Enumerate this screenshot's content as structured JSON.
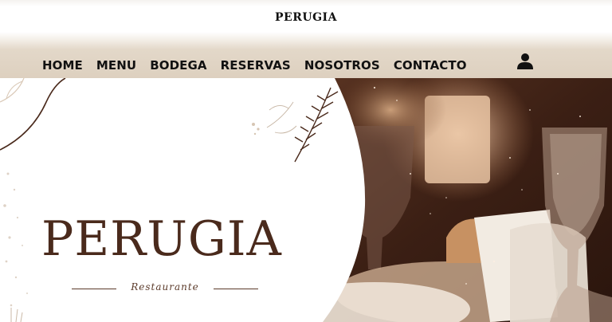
{
  "header": {
    "logo_text": "PERUGIA",
    "nav": [
      {
        "label": "HOME"
      },
      {
        "label": "MENU"
      },
      {
        "label": "BODEGA"
      },
      {
        "label": "RESERVAS"
      },
      {
        "label": "NOSOTROS"
      },
      {
        "label": "CONTACTO"
      }
    ],
    "user_icon": "user-icon"
  },
  "hero": {
    "title": "PERUGIA",
    "subtitle": "Restaurante"
  },
  "colors": {
    "brand_brown": "#4a2a1c",
    "header_tan": "#ddd0bf",
    "nav_text": "#111111"
  }
}
